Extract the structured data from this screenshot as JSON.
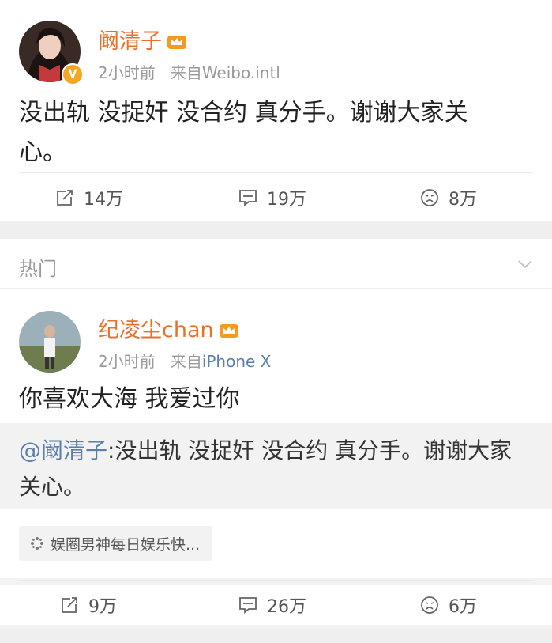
{
  "post1": {
    "author": "阚清子",
    "time": "2小时前",
    "source_prefix": "来自",
    "source": "Weibo.intl",
    "text": "没出轨 没捉奸 没合约 真分手。谢谢大家关心。",
    "reposts": "14万",
    "comments": "19万",
    "likes": "8万",
    "badge": "V"
  },
  "hot": {
    "label": "热门"
  },
  "post2": {
    "author": "纪凌尘chan",
    "time": "2小时前",
    "source_prefix": "来自",
    "source": "iPhone X",
    "text": "你喜欢大海 我爱过你",
    "repost_mention": "@阚清子",
    "repost_text": ":没出轨 没捉奸 没合约 真分手。谢谢大家关心。",
    "topic_tag": "娱圈男神每日娱乐快...",
    "reposts": "9万",
    "comments": "26万",
    "likes": "6万"
  },
  "icons": {
    "repost": "repost-icon",
    "comment": "comment-icon",
    "like": "sad-face-icon",
    "crown": "crown-vip-icon",
    "chevron": "chevron-down-icon",
    "topic": "topic-sparkle-icon"
  },
  "colors": {
    "name": "#e8702a",
    "link": "#5b7fad",
    "meta": "#999999"
  }
}
